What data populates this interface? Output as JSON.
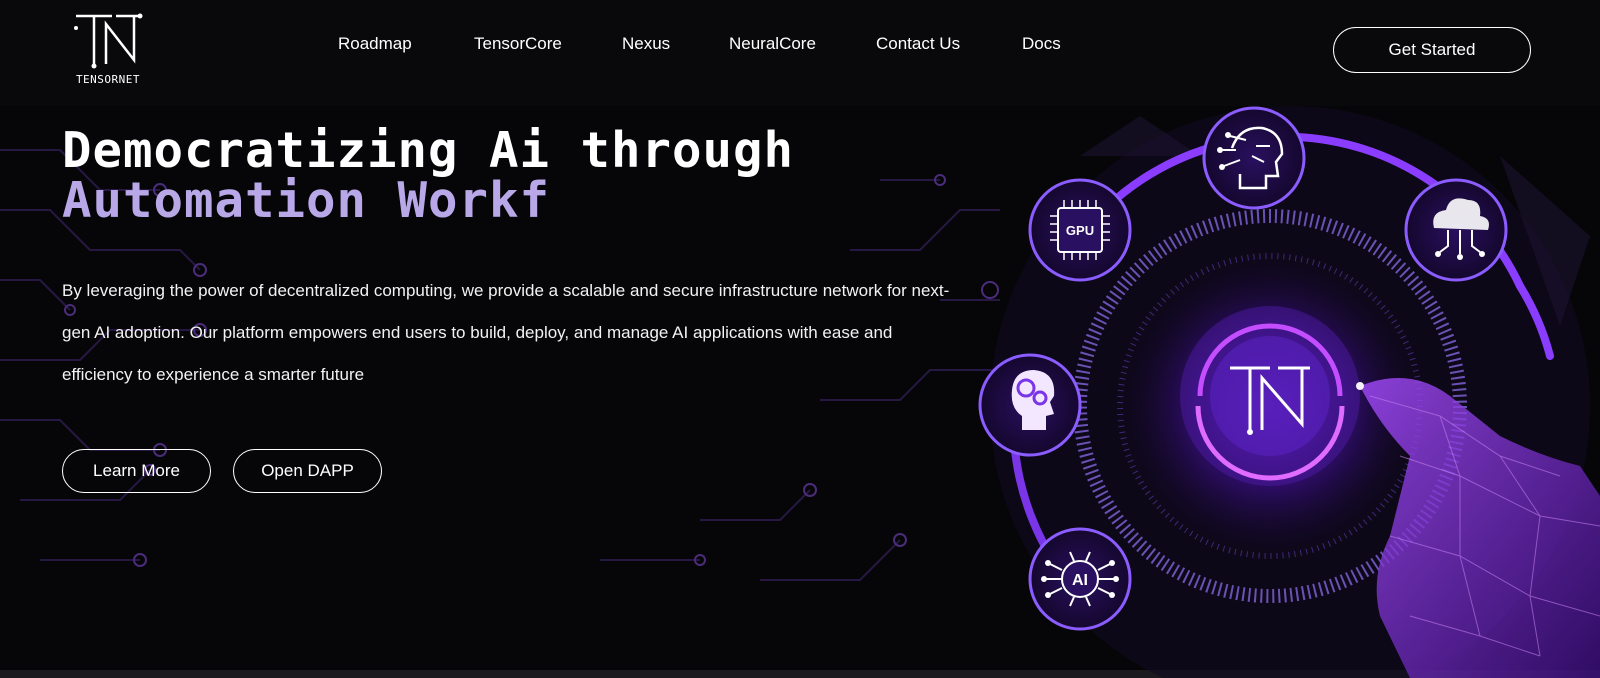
{
  "brand": {
    "logo_text": "TENSORNET",
    "logo_mark": "TN"
  },
  "nav": {
    "items": [
      "Roadmap",
      "TensorCore",
      "Nexus",
      "NeuralCore",
      "Contact Us",
      "Docs"
    ],
    "cta_label": "Get Started"
  },
  "hero": {
    "title_line1": "Democratizing Ai through",
    "title_line2": "Automation Workf",
    "description": "By leveraging the power of decentralized computing, we provide a scalable and secure infrastructure network for next-gen AI adoption. Our platform empowers end users to build, deploy, and manage AI applications with ease and efficiency to experience a smarter future",
    "buttons": {
      "learn_more": "Learn More",
      "open_dapp": "Open DAPP"
    }
  },
  "illustration": {
    "center_mark": "TN",
    "nodes": [
      {
        "name": "ai-head-circuit-icon",
        "label": ""
      },
      {
        "name": "gpu-chip-icon",
        "label": "GPU"
      },
      {
        "name": "cloud-network-icon",
        "label": ""
      },
      {
        "name": "brain-gears-icon",
        "label": ""
      },
      {
        "name": "ai-chip-icon",
        "label": "AI"
      }
    ]
  },
  "colors": {
    "background": "#060608",
    "accent_purple": "#8b3dff",
    "accent_violet": "#b9a8e8",
    "ring_glow": "#c44dff"
  }
}
